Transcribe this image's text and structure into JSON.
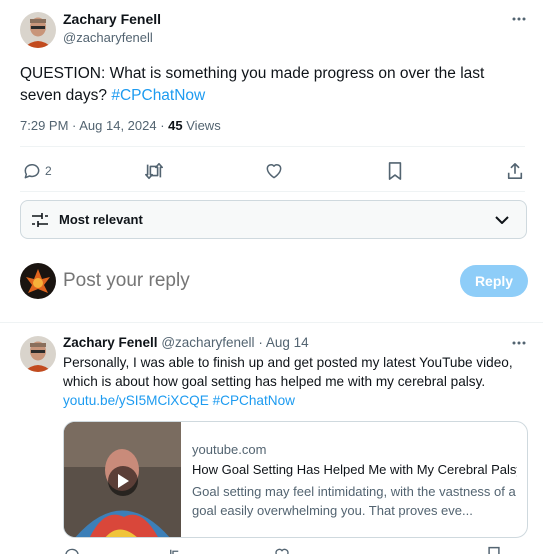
{
  "main_tweet": {
    "author_name": "Zachary Fenell",
    "author_handle": "@zacharyfenell",
    "text_prefix": "QUESTION: What is something you made progress on over the last seven days?",
    "hashtag": "#CPChatNow",
    "timestamp": "7:29 PM · Aug 14, 2024 · ",
    "views_count": "45",
    "views_label": "Views",
    "replies_count": "2"
  },
  "sort": {
    "label": "Most relevant"
  },
  "reply_box": {
    "placeholder": "Post your reply",
    "button_label": "Reply"
  },
  "reply_tweet": {
    "author_name": "Zachary Fenell",
    "author_handle": "@zacharyfenell",
    "separator": " · ",
    "date": "Aug 14",
    "text": "Personally, I was able to finish up and get posted my latest YouTube video, which is about how goal setting has helped me with my cerebral palsy.",
    "link": "youtu.be/ySI5MCiXCQE",
    "hashtag": "#CPChatNow",
    "card": {
      "domain": "youtube.com",
      "title": "How Goal Setting Has Helped Me with My Cerebral Palsy",
      "description": "Goal setting may feel intimidating, with the vastness of a goal easily overwhelming you. That proves eve..."
    }
  },
  "colors": {
    "accent": "#1d9bf0",
    "reply_button_disabled": "#8ecdf8",
    "muted_text": "#536471"
  }
}
